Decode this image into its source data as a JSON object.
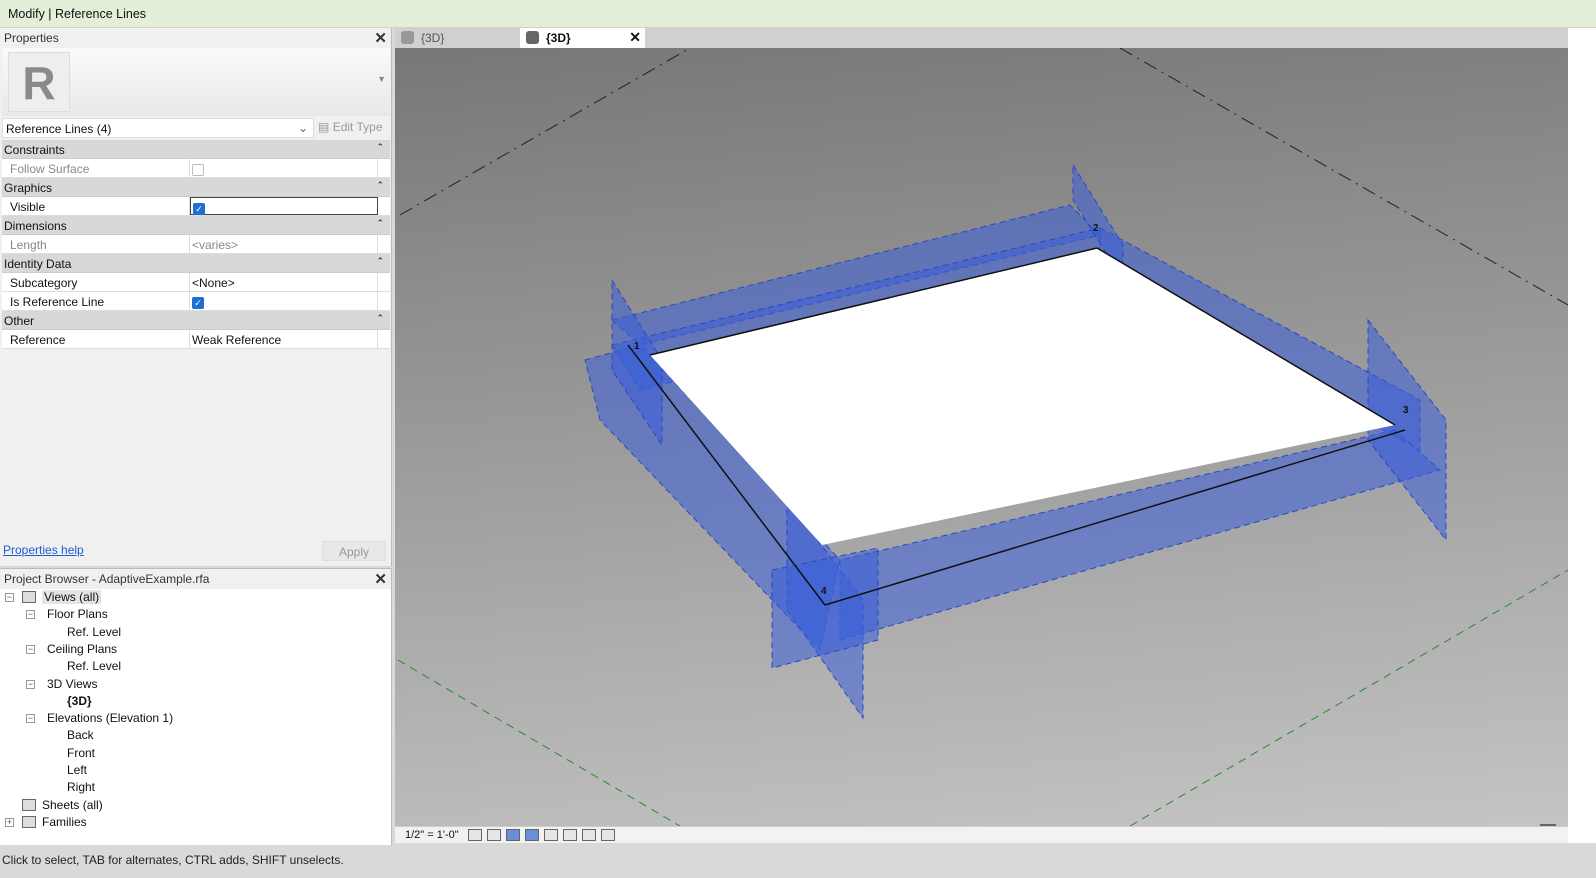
{
  "title": "Modify | Reference Lines",
  "properties": {
    "title": "Properties",
    "type_selector": "Reference Lines (4)",
    "edit_type": "Edit Type",
    "logo": "R",
    "sections": [
      {
        "name": "Constraints",
        "rows": [
          {
            "key": "Follow Surface",
            "type": "checkbox",
            "checked": false,
            "disabled": true
          }
        ]
      },
      {
        "name": "Graphics",
        "rows": [
          {
            "key": "Visible",
            "type": "checkbox",
            "checked": true
          }
        ]
      },
      {
        "name": "Dimensions",
        "rows": [
          {
            "key": "Length",
            "value": "<varies>",
            "disabled": true
          }
        ]
      },
      {
        "name": "Identity Data",
        "rows": [
          {
            "key": "Subcategory",
            "value": "<None>"
          },
          {
            "key": "Is Reference Line",
            "type": "checkbox",
            "checked": true
          }
        ]
      },
      {
        "name": "Other",
        "rows": [
          {
            "key": "Reference",
            "value": "Weak Reference"
          }
        ]
      }
    ],
    "help": "Properties help",
    "apply": "Apply"
  },
  "browser": {
    "title": "Project Browser - AdaptiveExample.rfa",
    "tree": [
      {
        "label": "Views (all)",
        "level": 0,
        "toggle": "−"
      },
      {
        "label": "Floor Plans",
        "level": 1,
        "toggle": "−"
      },
      {
        "label": "Ref. Level",
        "level": 2
      },
      {
        "label": "Ceiling Plans",
        "level": 1,
        "toggle": "−"
      },
      {
        "label": "Ref. Level",
        "level": 2
      },
      {
        "label": "3D Views",
        "level": 1,
        "toggle": "−"
      },
      {
        "label": "{3D}",
        "level": 2,
        "bold": true
      },
      {
        "label": "Elevations (Elevation 1)",
        "level": 1,
        "toggle": "−"
      },
      {
        "label": "Back",
        "level": 2
      },
      {
        "label": "Front",
        "level": 2
      },
      {
        "label": "Left",
        "level": 2
      },
      {
        "label": "Right",
        "level": 2
      },
      {
        "label": "Sheets (all)",
        "level": 0
      },
      {
        "label": "Families",
        "level": 0,
        "toggle": "+"
      }
    ]
  },
  "tabs": [
    {
      "label": "{3D}",
      "active": false
    },
    {
      "label": "{3D}",
      "active": true
    }
  ],
  "viewport": {
    "points": [
      "1",
      "2",
      "3",
      "4"
    ],
    "selection_color": "#3a5fd8",
    "background": "#9a9a9a"
  },
  "viewbar": {
    "scale": "1/2\" = 1'-0\"",
    "icons": [
      "detail-level-icon",
      "visual-style-icon",
      "sun-path-off-icon",
      "shadows-icon",
      "render-icon",
      "lock-view-icon",
      "crop-view-icon",
      "show-crop-icon"
    ]
  },
  "status": "Click to select, TAB for alternates, CTRL adds, SHIFT unselects."
}
